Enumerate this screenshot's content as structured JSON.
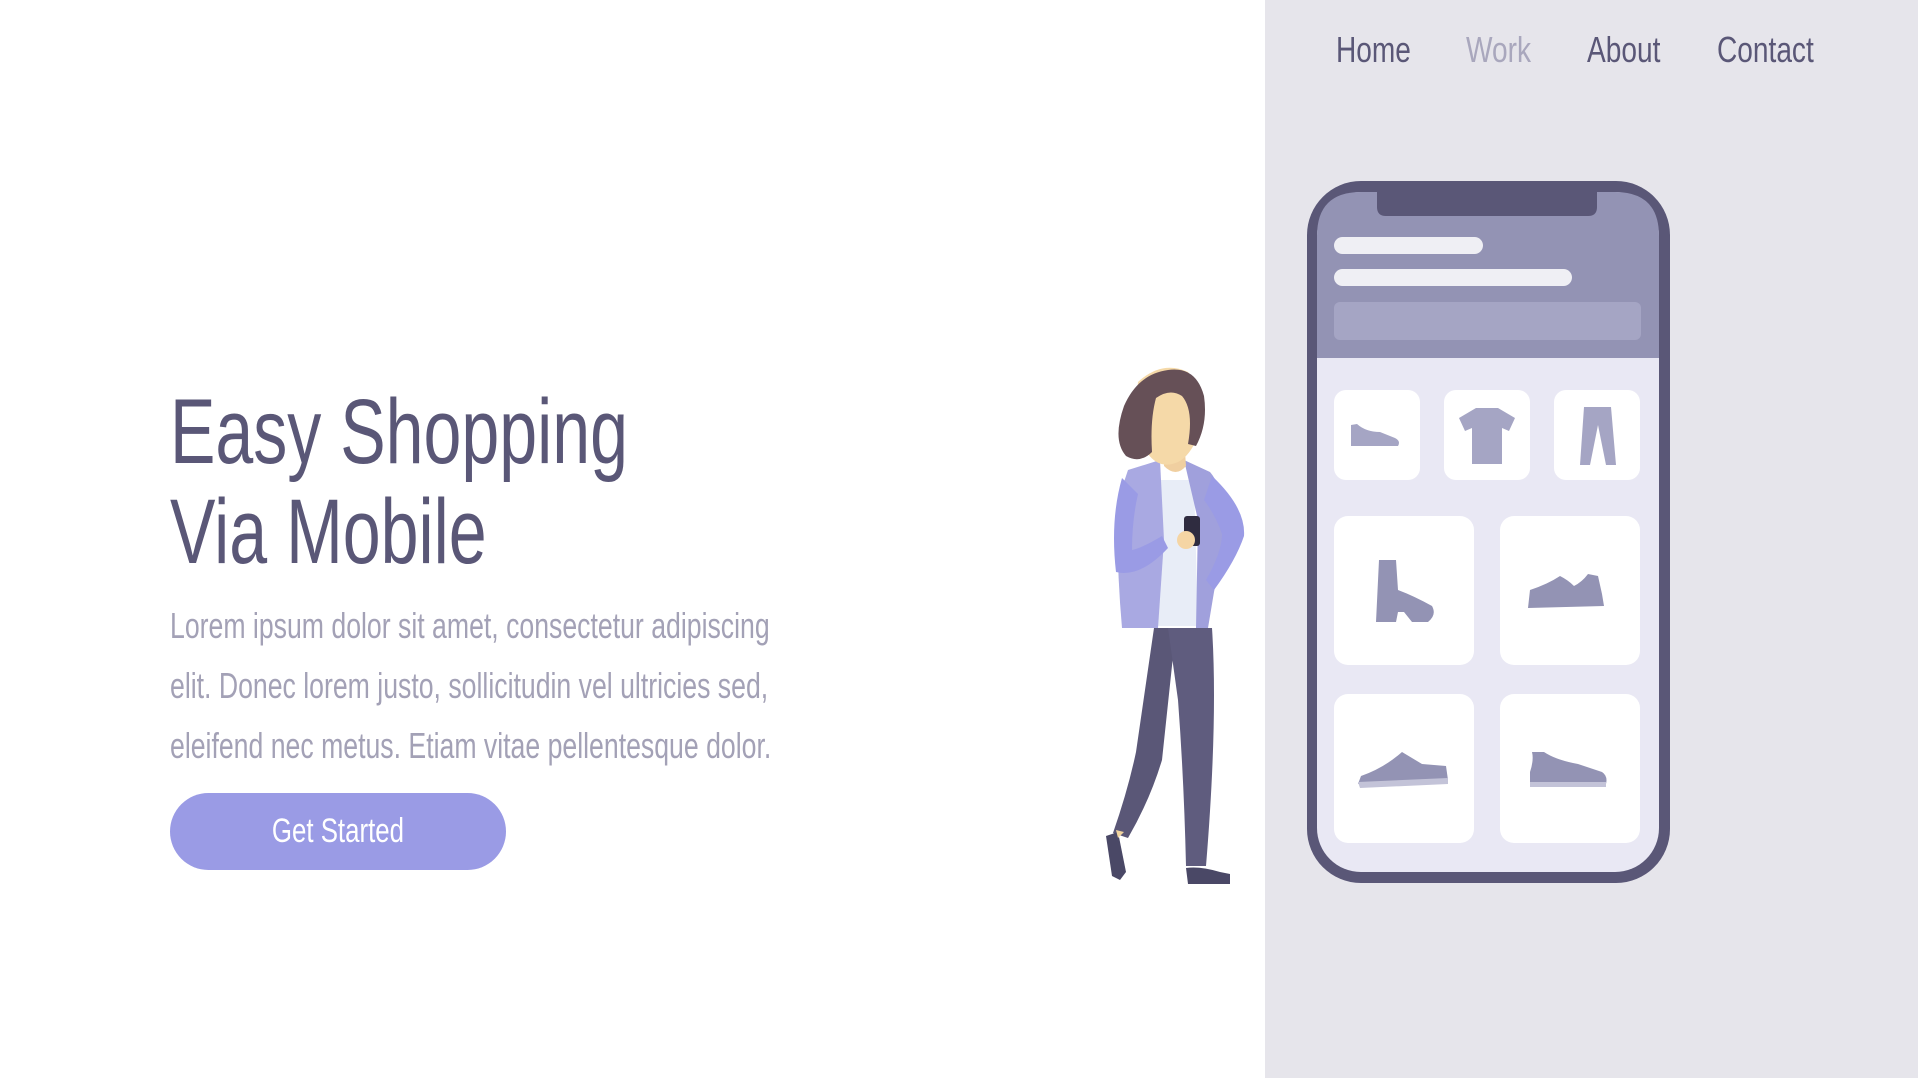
{
  "nav": {
    "items": [
      {
        "label": "Home",
        "active": false
      },
      {
        "label": "Work",
        "active": true
      },
      {
        "label": "About",
        "active": false
      },
      {
        "label": "Contact",
        "active": false
      }
    ]
  },
  "hero": {
    "title_line1": "Easy Shopping",
    "title_line2": "Via Mobile",
    "desc_line1": "Lorem ipsum dolor sit amet, consectetur adipiscing",
    "desc_line2": "elit. Donec lorem justo, sollicitudin vel ultricies sed,",
    "desc_line3": "eleifend nec metus. Etiam vitae pellentesque dolor.",
    "cta_label": "Get Started"
  },
  "colors": {
    "text_primary": "#5a5777",
    "text_muted": "#a3a1b6",
    "accent": "#9a9be5",
    "panel_bg": "#e6e5eb",
    "phone_frame": "#5a5777"
  },
  "illustration": {
    "phone_icons": [
      "sneaker-icon",
      "tshirt-icon",
      "pants-icon",
      "boot-icon",
      "sneaker-icon",
      "sneaker-icon",
      "sneaker-icon"
    ],
    "figure": "woman-holding-phone"
  }
}
